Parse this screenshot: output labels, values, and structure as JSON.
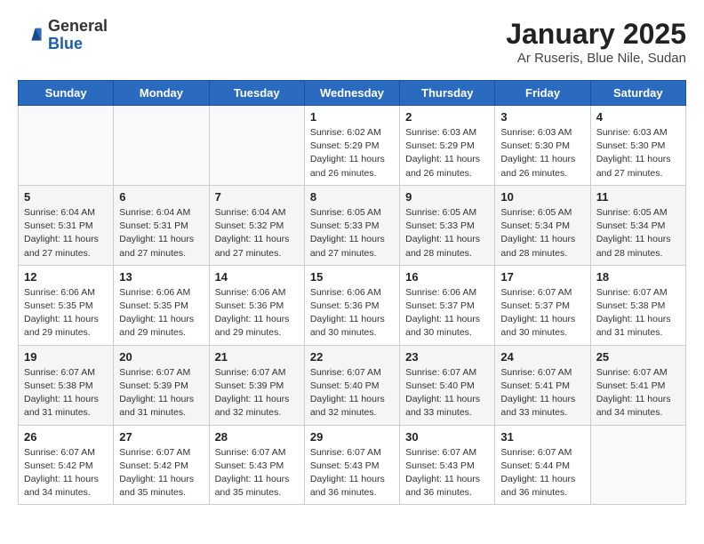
{
  "header": {
    "logo_general": "General",
    "logo_blue": "Blue",
    "month_title": "January 2025",
    "subtitle": "Ar Ruseris, Blue Nile, Sudan"
  },
  "days_of_week": [
    "Sunday",
    "Monday",
    "Tuesday",
    "Wednesday",
    "Thursday",
    "Friday",
    "Saturday"
  ],
  "weeks": [
    [
      {
        "day": "",
        "info": ""
      },
      {
        "day": "",
        "info": ""
      },
      {
        "day": "",
        "info": ""
      },
      {
        "day": "1",
        "info": "Sunrise: 6:02 AM\nSunset: 5:29 PM\nDaylight: 11 hours\nand 26 minutes."
      },
      {
        "day": "2",
        "info": "Sunrise: 6:03 AM\nSunset: 5:29 PM\nDaylight: 11 hours\nand 26 minutes."
      },
      {
        "day": "3",
        "info": "Sunrise: 6:03 AM\nSunset: 5:30 PM\nDaylight: 11 hours\nand 26 minutes."
      },
      {
        "day": "4",
        "info": "Sunrise: 6:03 AM\nSunset: 5:30 PM\nDaylight: 11 hours\nand 27 minutes."
      }
    ],
    [
      {
        "day": "5",
        "info": "Sunrise: 6:04 AM\nSunset: 5:31 PM\nDaylight: 11 hours\nand 27 minutes."
      },
      {
        "day": "6",
        "info": "Sunrise: 6:04 AM\nSunset: 5:31 PM\nDaylight: 11 hours\nand 27 minutes."
      },
      {
        "day": "7",
        "info": "Sunrise: 6:04 AM\nSunset: 5:32 PM\nDaylight: 11 hours\nand 27 minutes."
      },
      {
        "day": "8",
        "info": "Sunrise: 6:05 AM\nSunset: 5:33 PM\nDaylight: 11 hours\nand 27 minutes."
      },
      {
        "day": "9",
        "info": "Sunrise: 6:05 AM\nSunset: 5:33 PM\nDaylight: 11 hours\nand 28 minutes."
      },
      {
        "day": "10",
        "info": "Sunrise: 6:05 AM\nSunset: 5:34 PM\nDaylight: 11 hours\nand 28 minutes."
      },
      {
        "day": "11",
        "info": "Sunrise: 6:05 AM\nSunset: 5:34 PM\nDaylight: 11 hours\nand 28 minutes."
      }
    ],
    [
      {
        "day": "12",
        "info": "Sunrise: 6:06 AM\nSunset: 5:35 PM\nDaylight: 11 hours\nand 29 minutes."
      },
      {
        "day": "13",
        "info": "Sunrise: 6:06 AM\nSunset: 5:35 PM\nDaylight: 11 hours\nand 29 minutes."
      },
      {
        "day": "14",
        "info": "Sunrise: 6:06 AM\nSunset: 5:36 PM\nDaylight: 11 hours\nand 29 minutes."
      },
      {
        "day": "15",
        "info": "Sunrise: 6:06 AM\nSunset: 5:36 PM\nDaylight: 11 hours\nand 30 minutes."
      },
      {
        "day": "16",
        "info": "Sunrise: 6:06 AM\nSunset: 5:37 PM\nDaylight: 11 hours\nand 30 minutes."
      },
      {
        "day": "17",
        "info": "Sunrise: 6:07 AM\nSunset: 5:37 PM\nDaylight: 11 hours\nand 30 minutes."
      },
      {
        "day": "18",
        "info": "Sunrise: 6:07 AM\nSunset: 5:38 PM\nDaylight: 11 hours\nand 31 minutes."
      }
    ],
    [
      {
        "day": "19",
        "info": "Sunrise: 6:07 AM\nSunset: 5:38 PM\nDaylight: 11 hours\nand 31 minutes."
      },
      {
        "day": "20",
        "info": "Sunrise: 6:07 AM\nSunset: 5:39 PM\nDaylight: 11 hours\nand 31 minutes."
      },
      {
        "day": "21",
        "info": "Sunrise: 6:07 AM\nSunset: 5:39 PM\nDaylight: 11 hours\nand 32 minutes."
      },
      {
        "day": "22",
        "info": "Sunrise: 6:07 AM\nSunset: 5:40 PM\nDaylight: 11 hours\nand 32 minutes."
      },
      {
        "day": "23",
        "info": "Sunrise: 6:07 AM\nSunset: 5:40 PM\nDaylight: 11 hours\nand 33 minutes."
      },
      {
        "day": "24",
        "info": "Sunrise: 6:07 AM\nSunset: 5:41 PM\nDaylight: 11 hours\nand 33 minutes."
      },
      {
        "day": "25",
        "info": "Sunrise: 6:07 AM\nSunset: 5:41 PM\nDaylight: 11 hours\nand 34 minutes."
      }
    ],
    [
      {
        "day": "26",
        "info": "Sunrise: 6:07 AM\nSunset: 5:42 PM\nDaylight: 11 hours\nand 34 minutes."
      },
      {
        "day": "27",
        "info": "Sunrise: 6:07 AM\nSunset: 5:42 PM\nDaylight: 11 hours\nand 35 minutes."
      },
      {
        "day": "28",
        "info": "Sunrise: 6:07 AM\nSunset: 5:43 PM\nDaylight: 11 hours\nand 35 minutes."
      },
      {
        "day": "29",
        "info": "Sunrise: 6:07 AM\nSunset: 5:43 PM\nDaylight: 11 hours\nand 36 minutes."
      },
      {
        "day": "30",
        "info": "Sunrise: 6:07 AM\nSunset: 5:43 PM\nDaylight: 11 hours\nand 36 minutes."
      },
      {
        "day": "31",
        "info": "Sunrise: 6:07 AM\nSunset: 5:44 PM\nDaylight: 11 hours\nand 36 minutes."
      },
      {
        "day": "",
        "info": ""
      }
    ]
  ]
}
